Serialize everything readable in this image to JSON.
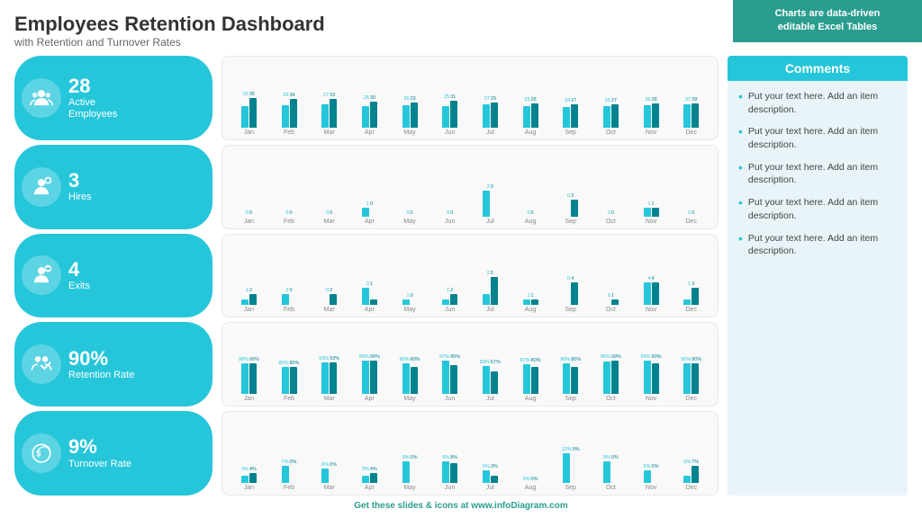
{
  "header": {
    "title": "Employees Retention Dashboard",
    "subtitle": "with Retention and Turnover Rates"
  },
  "banner": {
    "line1": "Charts are data-driven",
    "line2": "editable Excel Tables"
  },
  "kpis": [
    {
      "value": "28",
      "label": "Active\nEmployees",
      "icon": "employees"
    },
    {
      "value": "3",
      "label": "Hires",
      "icon": "hires"
    },
    {
      "value": "4",
      "label": "Exits",
      "icon": "exits"
    },
    {
      "value": "90%",
      "label": "Retention Rate",
      "icon": "retention"
    },
    {
      "value": "9%",
      "label": "Turnover Rate",
      "icon": "turnover"
    }
  ],
  "charts": [
    {
      "months": [
        "Jan",
        "Feb",
        "Mar",
        "Apr",
        "May",
        "Jun",
        "Jul",
        "Aug",
        "Sep",
        "Oct",
        "Nov",
        "Dec"
      ],
      "series1": [
        25,
        26,
        27,
        25,
        26,
        25,
        27,
        25,
        24,
        25,
        26,
        27
      ],
      "series2": [
        35,
        34,
        33,
        30,
        29,
        31,
        29,
        28,
        27,
        27,
        28,
        28
      ],
      "maxVal": 40
    },
    {
      "months": [
        "Jan",
        "Feb",
        "Mar",
        "Apr",
        "May",
        "Jun",
        "Jul",
        "Aug",
        "Sep",
        "Oct",
        "Nov",
        "Dec"
      ],
      "series1": [
        0,
        0,
        0,
        1,
        0,
        0,
        3,
        0,
        0,
        0,
        1,
        0
      ],
      "series2": [
        0,
        0,
        0,
        0,
        0,
        0,
        0,
        0,
        2,
        0,
        1,
        0
      ],
      "maxVal": 4
    },
    {
      "months": [
        "Jan",
        "Feb",
        "Mar",
        "Apr",
        "May",
        "Jun",
        "Jul",
        "Aug",
        "Sep",
        "Oct",
        "Nov",
        "Dec"
      ],
      "series1": [
        1,
        2,
        0,
        3,
        1,
        1,
        2,
        1,
        0,
        0,
        4,
        1
      ],
      "series2": [
        2,
        0,
        2,
        1,
        0,
        2,
        5,
        1,
        4,
        1,
        4,
        3
      ],
      "maxVal": 6
    },
    {
      "months": [
        "Jan",
        "Feb",
        "Mar",
        "Apr",
        "May",
        "Jun",
        "Jul",
        "Aug",
        "Sep",
        "Oct",
        "Nov",
        "Dec"
      ],
      "series1": [
        90,
        80,
        93,
        99,
        90,
        97,
        83,
        87,
        90,
        95,
        99,
        90
      ],
      "series2": [
        90,
        80,
        93,
        99,
        80,
        85,
        67,
        80,
        80,
        99,
        90,
        90
      ],
      "maxVal": 100,
      "isPercent": true
    },
    {
      "months": [
        "Jan",
        "Feb",
        "Mar",
        "Apr",
        "May",
        "Jun",
        "Jul",
        "Aug",
        "Sep",
        "Oct",
        "Nov",
        "Dec"
      ],
      "series1": [
        3,
        7,
        6,
        3,
        9,
        9,
        5,
        0,
        12,
        9,
        5,
        3
      ],
      "series2": [
        4,
        0,
        0,
        4,
        0,
        8,
        3,
        0,
        0,
        0,
        0,
        7
      ],
      "maxVal": 14,
      "isPercent": true
    }
  ],
  "comments": {
    "header": "Comments",
    "items": [
      "Put your text here. Add an item description.",
      "Put your text here. Add an item description.",
      "Put your text here. Add an item description.",
      "Put your text here. Add an item description.",
      "Put your text here. Add an item description."
    ]
  },
  "footer": {
    "text": "Get these slides & icons at www.",
    "brand": "infoDiagram",
    "suffix": ".com"
  }
}
